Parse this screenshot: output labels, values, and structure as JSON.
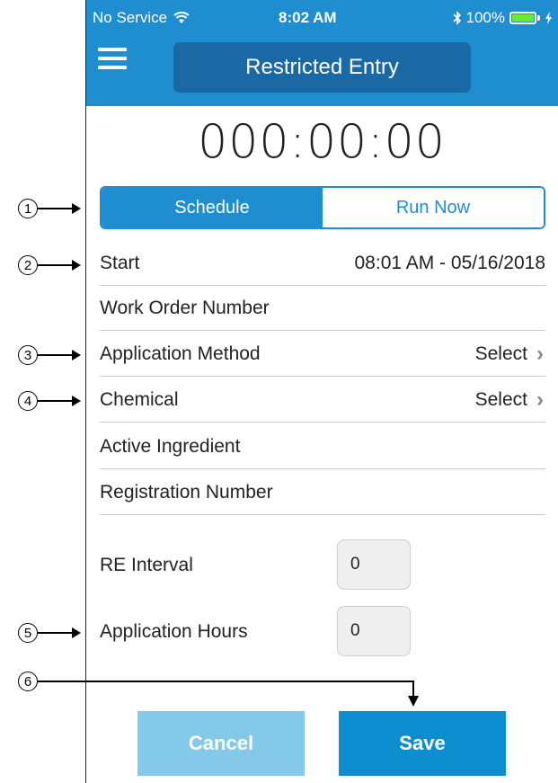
{
  "status_bar": {
    "carrier": "No Service",
    "time": "8:02 AM",
    "battery": "100%"
  },
  "header": {
    "title": "Restricted Entry"
  },
  "timer": "000:00:00",
  "mode_toggle": {
    "options": [
      "Schedule",
      "Run Now"
    ],
    "selected": "Schedule"
  },
  "form": {
    "start": {
      "label": "Start",
      "value": "08:01 AM - 05/16/2018"
    },
    "work_order": {
      "label": "Work Order Number"
    },
    "application_method": {
      "label": "Application Method",
      "value": "Select"
    },
    "chemical": {
      "label": "Chemical",
      "value": "Select"
    },
    "active_ingredient": {
      "label": "Active Ingredient"
    },
    "registration_number": {
      "label": "Registration Number"
    },
    "re_interval": {
      "label": "RE Interval",
      "value": "0"
    },
    "application_hours": {
      "label": "Application Hours",
      "value": "0"
    }
  },
  "buttons": {
    "cancel": "Cancel",
    "save": "Save"
  },
  "callouts": [
    "1",
    "2",
    "3",
    "4",
    "5",
    "6"
  ],
  "colors": {
    "primary": "#1e8ed1",
    "title_box": "#1a69a5",
    "cancel": "#84c9ea",
    "save": "#0c8ed0"
  }
}
